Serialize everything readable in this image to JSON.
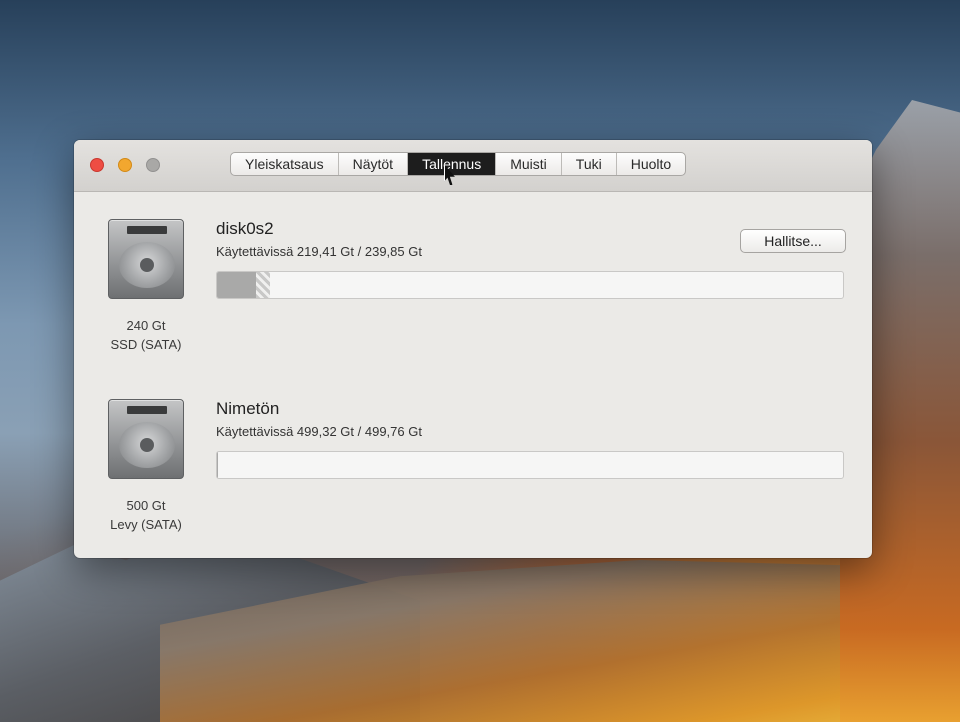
{
  "window": {
    "tabs": [
      {
        "label": "Yleiskatsaus",
        "active": false
      },
      {
        "label": "Näytöt",
        "active": false
      },
      {
        "label": "Tallennus",
        "active": true
      },
      {
        "label": "Muisti",
        "active": false
      },
      {
        "label": "Tuki",
        "active": false
      },
      {
        "label": "Huolto",
        "active": false
      }
    ]
  },
  "disks": [
    {
      "name": "disk0s2",
      "available": "Käytettävissä 219,41 Gt / 239,85 Gt",
      "size": "240 Gt",
      "type": "SSD (SATA)",
      "manage_label": "Hallitse...",
      "used_fraction": 0.0616
    },
    {
      "name": "Nimetön",
      "available": "Käytettävissä 499,32 Gt / 499,76 Gt",
      "size": "500 Gt",
      "type": "Levy (SATA)",
      "used_fraction": 0.0009
    }
  ],
  "colors": {
    "close": "#ee4d43",
    "minimize": "#f2a72f",
    "zoom": "#a9a8a6",
    "active_tab": "#1d1d1d",
    "used_storage": "#a9a9a8"
  }
}
